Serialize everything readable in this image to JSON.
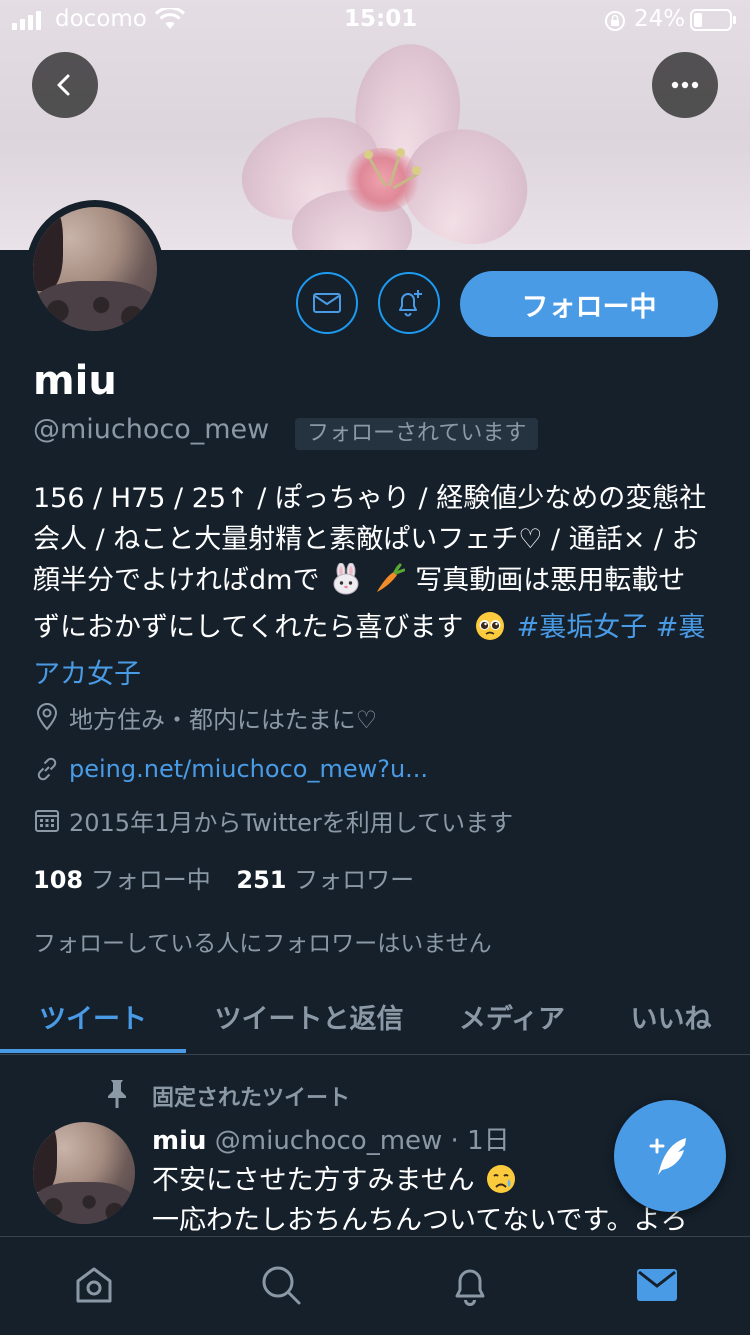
{
  "status_bar": {
    "carrier": "docomo",
    "time": "15:01",
    "battery": "24%",
    "battery_level": 0.24
  },
  "profile": {
    "name": "miu",
    "handle": "@miuchoco_mew",
    "follows_you": "フォローされています",
    "follow_button": "フォロー中",
    "bio": {
      "line1": "156 / H75 / 25↑ / ぽっちゃり / 経験値少なめの変態社",
      "line2": "会人 / ねこと大量射精と素敵ぱいフェチ♡ / 通話× / お",
      "line3a": "顔半分でよければdmで",
      "line3b": "写真動画は悪用転載せ",
      "line4a": "ずにおかずにしてくれたら喜びます",
      "tag1": "#裏垢女子",
      "tag2_a": "#裏",
      "tag2_b": "アカ女子"
    },
    "location": "地方住み・都内にはたまに♡",
    "website": "peing.net/miuchoco_mew?u...",
    "joined": "2015年1月からTwitterを利用しています",
    "following_count": "108",
    "following_label": "フォロー中",
    "followers_count": "251",
    "followers_label": "フォロワー",
    "no_mutual": "フォローしている人にフォロワーはいません"
  },
  "tabs": [
    {
      "label": "ツイート"
    },
    {
      "label": "ツイートと返信"
    },
    {
      "label": "メディア"
    },
    {
      "label": "いいね"
    }
  ],
  "pinned_tweet": {
    "pinned_label": "固定されたツイート",
    "name": "miu",
    "handle": "@miuchoco_mew",
    "time": "· 1日",
    "line1": "不安にさせた方すみません",
    "line2": "一応わたしおちんちんついてないです。よろ"
  },
  "icons": {
    "back": "chevron-left-icon",
    "more": "more-icon",
    "message": "mail-icon",
    "notify": "bell-plus-icon",
    "location": "location-pin-icon",
    "link": "link-icon",
    "calendar": "calendar-icon",
    "pin": "pin-icon",
    "compose": "compose-tweet-icon",
    "nav": [
      "home-icon",
      "search-icon",
      "notifications-icon",
      "messages-icon"
    ]
  },
  "colors": {
    "background": "#15202b",
    "accent": "#4a9be6",
    "muted_text": "#8b98a5"
  }
}
